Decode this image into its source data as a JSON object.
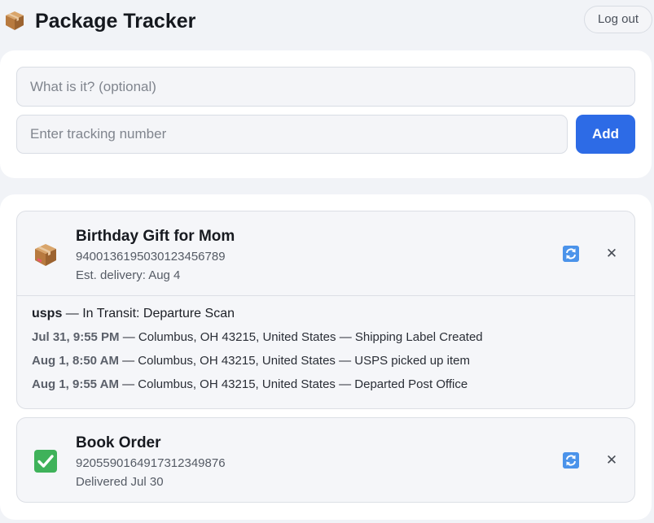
{
  "header": {
    "app_icon": "package-box-icon",
    "title": "Package Tracker",
    "logout_label": "Log out"
  },
  "add_form": {
    "label_placeholder": "What is it? (optional)",
    "label_value": "",
    "tracking_placeholder": "Enter tracking number",
    "tracking_value": "",
    "add_label": "Add"
  },
  "colors": {
    "accent": "#2d6be6",
    "refresh_icon": "#4b93ea",
    "delivered_check": "#3fb25a"
  },
  "packages": [
    {
      "icon": "package-box-icon",
      "name": "Birthday Gift for Mom",
      "tracking_number": "9400136195030123456789",
      "status_line": "Est. delivery: Aug 4",
      "refresh_icon": "refresh-icon",
      "close_icon": "close-icon",
      "close_glyph": "✕",
      "carrier": "usps",
      "summary": " — In Transit: Departure Scan",
      "events": [
        {
          "time": "Jul 31, 9:55 PM",
          "detail": " — Columbus, OH 43215, United States — Shipping Label Created"
        },
        {
          "time": "Aug 1, 8:50 AM",
          "detail": " — Columbus, OH 43215, United States — USPS picked up item"
        },
        {
          "time": "Aug 1, 9:55 AM",
          "detail": " — Columbus, OH 43215, United States — Departed Post Office"
        }
      ]
    },
    {
      "icon": "check-mark-icon",
      "name": "Book Order",
      "tracking_number": "9205590164917312349876",
      "status_line": "Delivered Jul 30",
      "refresh_icon": "refresh-icon",
      "close_icon": "close-icon",
      "close_glyph": "✕"
    }
  ]
}
